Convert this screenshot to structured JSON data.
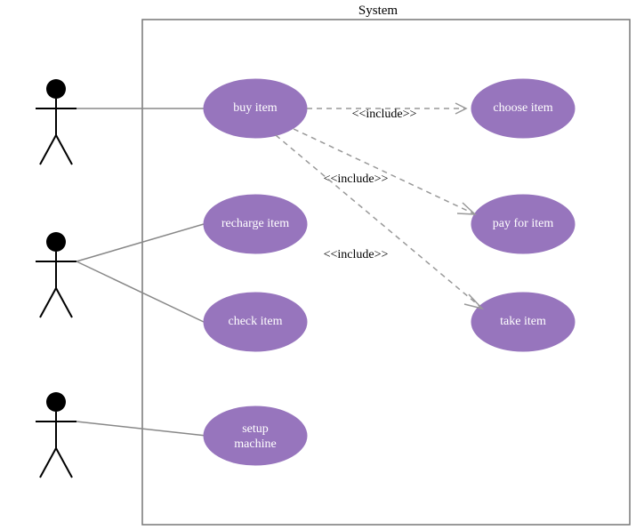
{
  "system_title": "System",
  "usecases": {
    "buy_item": "buy item",
    "recharge_item": "recharge  item",
    "check_item": "check  item",
    "setup_machine_l1": "setup",
    "setup_machine_l2": "machine",
    "choose_item": "choose  item",
    "pay_for_item": "pay for item",
    "take_item": "take item"
  },
  "relationships": {
    "include1": "<<include>>",
    "include2": "<<include>>",
    "include3": "<<include>>"
  }
}
